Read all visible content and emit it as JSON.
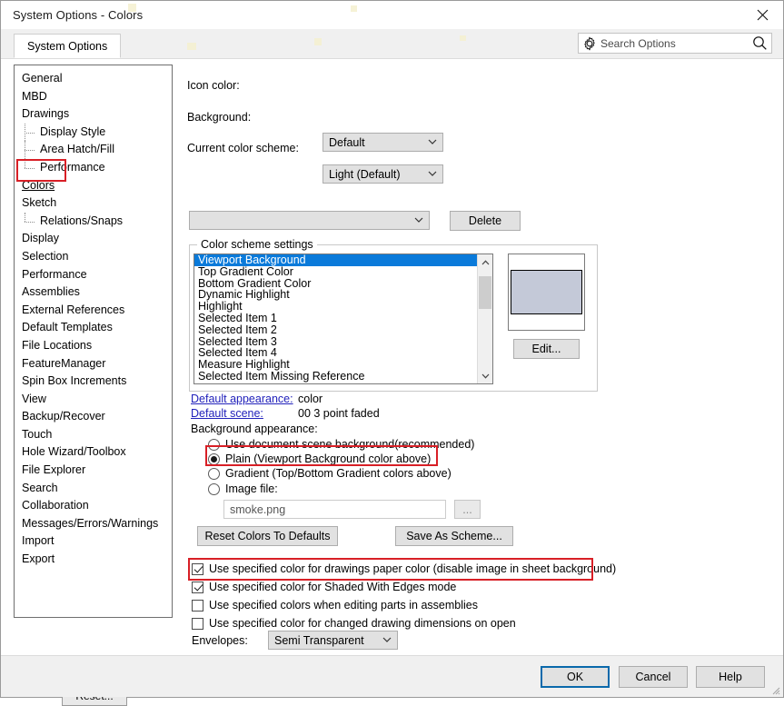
{
  "window": {
    "title": "System Options - Colors",
    "close_icon": "close-icon"
  },
  "tabstrip": {
    "tab_label": "System Options",
    "search": {
      "placeholder": "Search Options",
      "gear_icon": "gear-icon",
      "magnifier_icon": "search-icon"
    }
  },
  "tree": {
    "items": [
      {
        "label": "General",
        "level": 0
      },
      {
        "label": "MBD",
        "level": 0
      },
      {
        "label": "Drawings",
        "level": 0
      },
      {
        "label": "Display Style",
        "level": 1
      },
      {
        "label": "Area Hatch/Fill",
        "level": 1
      },
      {
        "label": "Performance",
        "level": 1
      },
      {
        "label": "Colors",
        "level": 0
      },
      {
        "label": "Sketch",
        "level": 0
      },
      {
        "label": "Relations/Snaps",
        "level": 1
      },
      {
        "label": "Display",
        "level": 0
      },
      {
        "label": "Selection",
        "level": 0
      },
      {
        "label": "Performance",
        "level": 0
      },
      {
        "label": "Assemblies",
        "level": 0
      },
      {
        "label": "External References",
        "level": 0
      },
      {
        "label": "Default Templates",
        "level": 0
      },
      {
        "label": "File Locations",
        "level": 0
      },
      {
        "label": "FeatureManager",
        "level": 0
      },
      {
        "label": "Spin Box Increments",
        "level": 0
      },
      {
        "label": "View",
        "level": 0
      },
      {
        "label": "Backup/Recover",
        "level": 0
      },
      {
        "label": "Touch",
        "level": 0
      },
      {
        "label": "Hole Wizard/Toolbox",
        "level": 0
      },
      {
        "label": "File Explorer",
        "level": 0
      },
      {
        "label": "Search",
        "level": 0
      },
      {
        "label": "Collaboration",
        "level": 0
      },
      {
        "label": "Messages/Errors/Warnings",
        "level": 0
      },
      {
        "label": "Import",
        "level": 0
      },
      {
        "label": "Export",
        "level": 0
      }
    ],
    "selected": "Colors",
    "reset_label": "Reset..."
  },
  "main": {
    "icon_color_label": "Icon color:",
    "icon_color_value": "Default",
    "background_label": "Background:",
    "background_value": "Light (Default)",
    "current_scheme_label": "Current color scheme:",
    "current_scheme_value": "",
    "delete_label": "Delete",
    "group_legend": "Color scheme settings",
    "scheme_items": [
      "Viewport Background",
      "Top Gradient Color",
      "Bottom Gradient Color",
      "Dynamic Highlight",
      "Highlight",
      "Selected Item 1",
      "Selected Item 2",
      "Selected Item 3",
      "Selected Item 4",
      "Measure Highlight",
      "Selected Item Missing Reference"
    ],
    "scheme_selected_index": 0,
    "preview_color": "#c4c9d8",
    "edit_label": "Edit...",
    "default_appearance_label": "Default appearance:",
    "default_appearance_value": "color",
    "default_scene_label": "Default scene:",
    "default_scene_value": "00 3 point faded",
    "background_appearance_label": "Background appearance:",
    "radios": [
      {
        "label": "Use document scene background(recommended)",
        "checked": false
      },
      {
        "label": "Plain (Viewport Background color above)",
        "checked": true
      },
      {
        "label": "Gradient (Top/Bottom Gradient colors above)",
        "checked": false
      },
      {
        "label": "Image file:",
        "checked": false
      }
    ],
    "image_file_value": "smoke.png",
    "browse_label": "...",
    "reset_colors_label": "Reset Colors To Defaults",
    "save_scheme_label": "Save As Scheme...",
    "checkboxes": [
      {
        "label": "Use specified color for drawings paper color (disable image in sheet background)",
        "checked": true
      },
      {
        "label": "Use specified color for Shaded With Edges mode",
        "checked": true
      },
      {
        "label": "Use specified colors when editing parts in assemblies",
        "checked": false
      },
      {
        "label": "Use specified color for changed drawing dimensions on open",
        "checked": false
      }
    ],
    "envelopes_label": "Envelopes:",
    "envelopes_value": "Semi Transparent"
  },
  "footer": {
    "ok_label": "OK",
    "cancel_label": "Cancel",
    "help_label": "Help"
  },
  "annotations": {
    "highlight_color": "#d81f26",
    "boxes": [
      "colors-tree-item",
      "plain-radio-option",
      "drawings-paper-color-checkbox"
    ]
  }
}
